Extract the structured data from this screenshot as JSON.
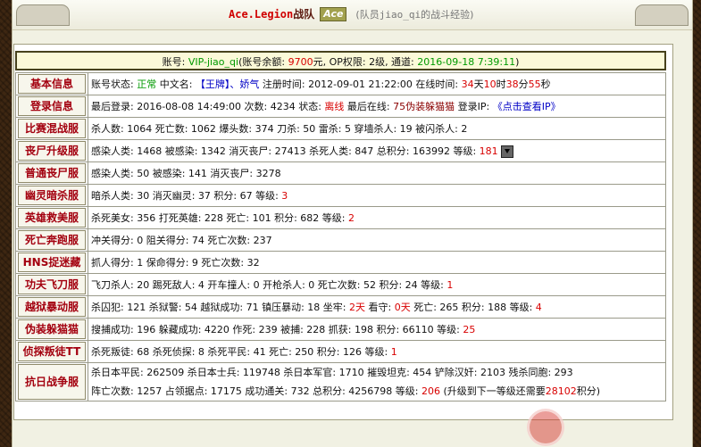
{
  "header": {
    "team_name": "Ace.Legion",
    "team_suffix": "战队",
    "logo_text": "Ace",
    "subtitle_pre": "(队员",
    "member_name": "jiao_qi",
    "subtitle_post": "的战斗经验)"
  },
  "account": {
    "prefix": "账号: ",
    "id": "VIP-jiao_qi",
    "balance_pre": "(账号余额: ",
    "balance": "9700",
    "balance_post": "元, OP权限: 2级, 通道: ",
    "date": "2016-09-18 7:39:11",
    "close": ")"
  },
  "rows": [
    {
      "label": "基本信息",
      "lines": [
        [
          {
            "t": "账号状态: "
          },
          {
            "t": "正常",
            "c": "green"
          },
          {
            "t": " 中文名: "
          },
          {
            "t": "【王牌】、娇气",
            "c": "blue"
          },
          {
            "t": " 注册时间: 2012-09-01 21:22:00 在线时间: "
          },
          {
            "t": "34",
            "c": "red"
          },
          {
            "t": "天"
          },
          {
            "t": "10",
            "c": "red"
          },
          {
            "t": "时"
          },
          {
            "t": "38",
            "c": "red"
          },
          {
            "t": "分"
          },
          {
            "t": "55",
            "c": "red"
          },
          {
            "t": "秒"
          }
        ]
      ]
    },
    {
      "label": "登录信息",
      "lines": [
        [
          {
            "t": "最后登录: 2016-08-08 14:49:00 次数: 4234 状态: "
          },
          {
            "t": "离线",
            "c": "red"
          },
          {
            "t": " 最后在线: "
          },
          {
            "t": "75伪装躲猫猫",
            "c": "dred"
          },
          {
            "t": " 登录IP: "
          },
          {
            "t": "《点击查看IP》",
            "c": "blue"
          }
        ]
      ]
    },
    {
      "label": "比赛混战服",
      "lines": [
        [
          {
            "t": "杀人数: 1064 死亡数: 1062 爆头数: 374 刀杀: 50 雷杀: 5 穿墙杀人: 19 被闪杀人: 2"
          }
        ]
      ]
    },
    {
      "label": "丧尸升级服",
      "lines": [
        [
          {
            "t": "感染人类: 1468 被感染: 1342 消灭丧尸: 27413 杀死人类: 847 总积分: 163992 等级: "
          },
          {
            "t": "181",
            "c": "red"
          }
        ]
      ],
      "icon": "rank-badge-icon"
    },
    {
      "label": "普通丧尸服",
      "lines": [
        [
          {
            "t": "感染人类: 50 被感染: 141 消灭丧尸: 3278"
          }
        ]
      ]
    },
    {
      "label": "幽灵暗杀服",
      "lines": [
        [
          {
            "t": "暗杀人类: 30 消灭幽灵: 37 积分: 67 等级: "
          },
          {
            "t": "3",
            "c": "red"
          }
        ]
      ]
    },
    {
      "label": "英雄救美服",
      "lines": [
        [
          {
            "t": "杀死美女: 356 打死英雄: 228 死亡: 101 积分: 682 等级: "
          },
          {
            "t": "2",
            "c": "red"
          }
        ]
      ]
    },
    {
      "label": "死亡奔跑服",
      "lines": [
        [
          {
            "t": "冲关得分: 0 阻关得分: 74 死亡次数: 237"
          }
        ]
      ]
    },
    {
      "label": "HNS捉迷藏",
      "lines": [
        [
          {
            "t": "抓人得分: 1 保命得分: 9 死亡次数: 32"
          }
        ]
      ]
    },
    {
      "label": "功夫飞刀服",
      "lines": [
        [
          {
            "t": "飞刀杀人: 20 踢死敌人: 4 开车撞人: 0 开枪杀人: 0 死亡次数: 52 积分: 24 等级: "
          },
          {
            "t": "1",
            "c": "red"
          }
        ]
      ]
    },
    {
      "label": "越狱暴动服",
      "lines": [
        [
          {
            "t": "杀囚犯: 121 杀狱警: 54 越狱成功: 71 镇压暴动: 18 坐牢: "
          },
          {
            "t": "2天",
            "c": "red"
          },
          {
            "t": " 看守: "
          },
          {
            "t": "0天",
            "c": "red"
          },
          {
            "t": " 死亡: 265 积分: 188 等级: "
          },
          {
            "t": "4",
            "c": "red"
          }
        ]
      ]
    },
    {
      "label": "伪装躲猫猫",
      "lines": [
        [
          {
            "t": "搜捕成功: 196 躲藏成功: 4220 作死: 239 被捕: 228 抓获: 198 积分: 66110 等级: "
          },
          {
            "t": "25",
            "c": "red"
          }
        ]
      ]
    },
    {
      "label": "侦探叛徒TT",
      "lines": [
        [
          {
            "t": "杀死叛徒: 68 杀死侦探: 8 杀死平民: 41 死亡: 250 积分: 126 等级: "
          },
          {
            "t": "1",
            "c": "red"
          }
        ]
      ]
    },
    {
      "label": "抗日战争服",
      "lines": [
        [
          {
            "t": "杀日本平民: 262509 杀日本士兵: 119748 杀日本军官: 1710 摧毁坦克: 454 铲除汉奸: 2103 残杀同胞: 293"
          }
        ],
        [
          {
            "t": "阵亡次数: 1257 占领据点: 17175 成功通关: 732 总积分: 4256798 等级: "
          },
          {
            "t": "206",
            "c": "red"
          },
          {
            "t": " (升级到下一等级还需要"
          },
          {
            "t": "28102",
            "c": "red"
          },
          {
            "t": "积分)"
          }
        ]
      ]
    }
  ],
  "colors": {
    "label_text": "#a3000f",
    "value_red": "#d80000",
    "value_green": "#009a00",
    "value_blue": "#0000c6"
  }
}
